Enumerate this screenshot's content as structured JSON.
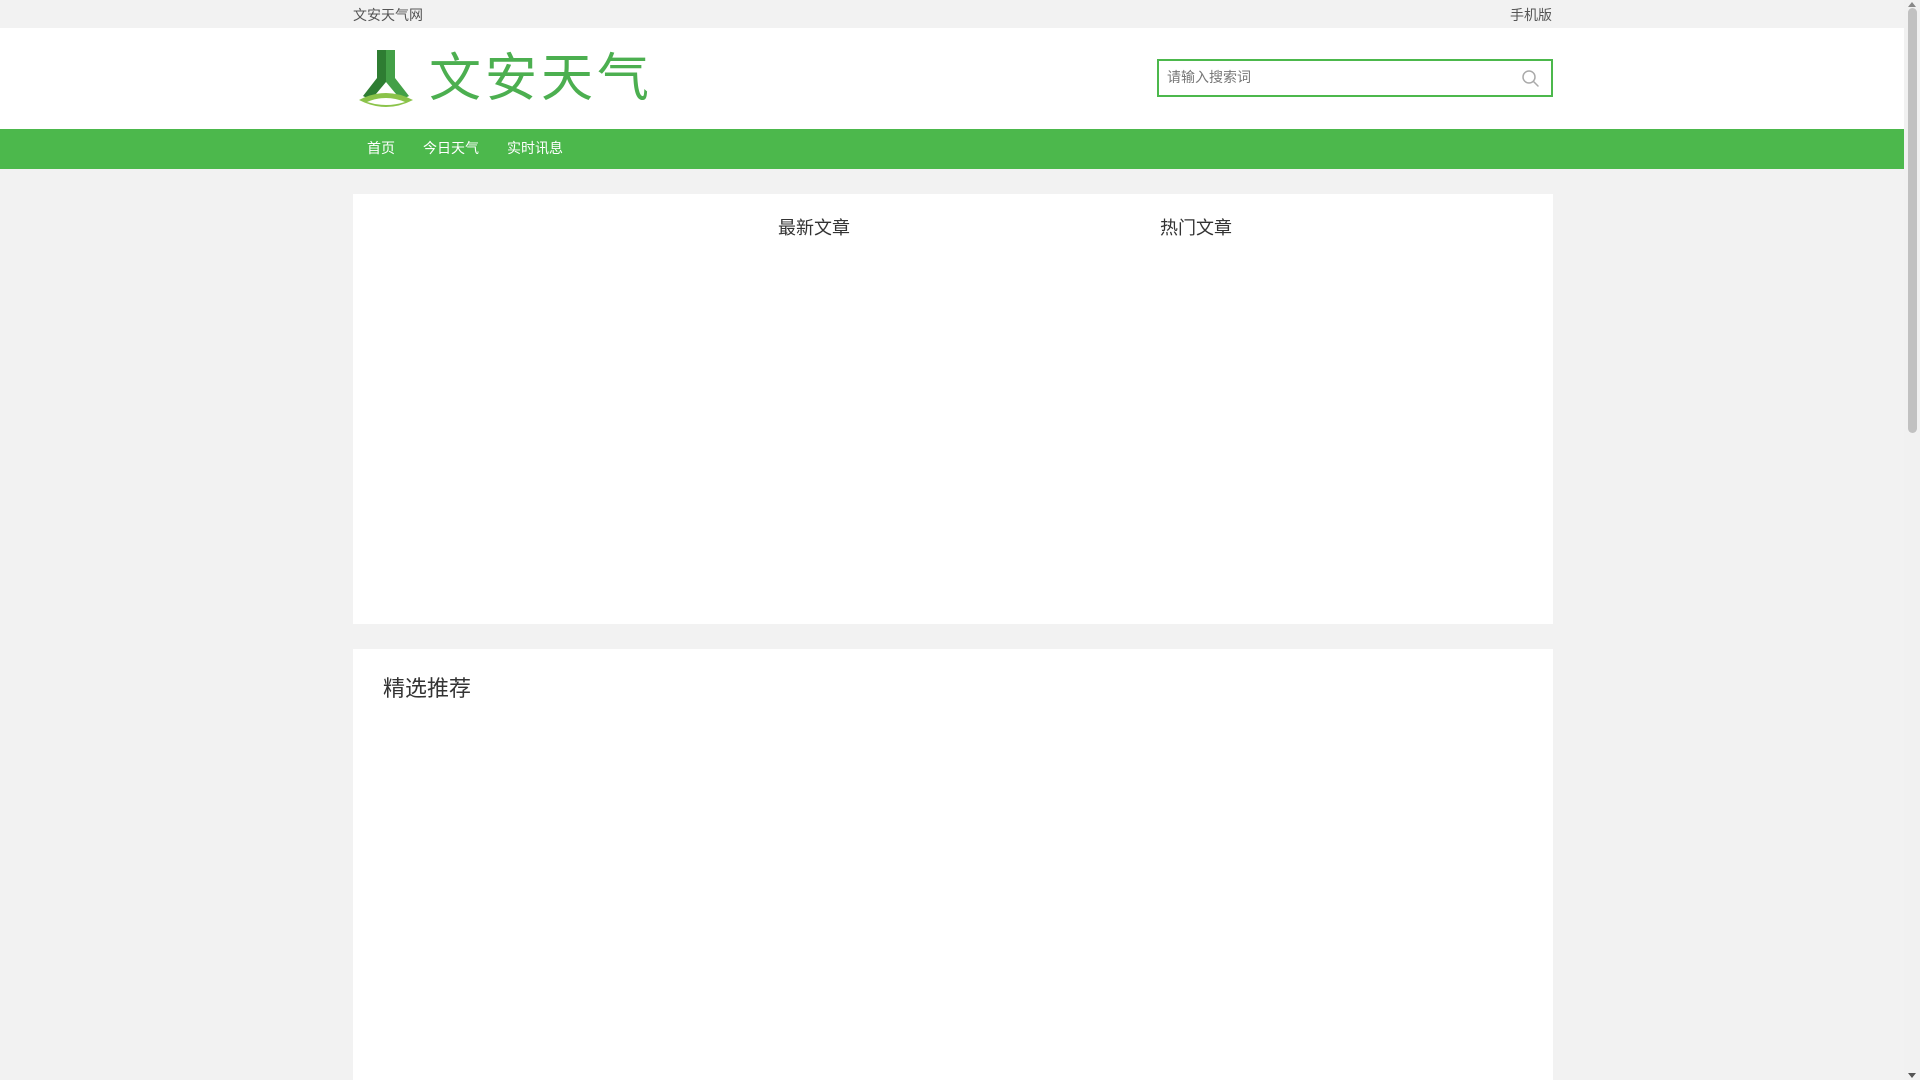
{
  "topbar": {
    "site_name": "文安天气网",
    "mobile_label": "手机版"
  },
  "header": {
    "logo_text": "文安天气",
    "search": {
      "placeholder": "请输入搜索词",
      "value": ""
    }
  },
  "nav": {
    "items": [
      {
        "label": "首页"
      },
      {
        "label": "今日天气"
      },
      {
        "label": "实时讯息"
      }
    ]
  },
  "panels": {
    "latest_title": "最新文章",
    "hot_title": "热门文章",
    "featured_title": "精选推荐"
  },
  "colors": {
    "brand_green": "#4cb84c",
    "logo_dark_green": "#2e7d32",
    "logo_light_green": "#8bc34a"
  },
  "icons": {
    "search": "search-icon",
    "logo": "logo-mark-icon"
  }
}
